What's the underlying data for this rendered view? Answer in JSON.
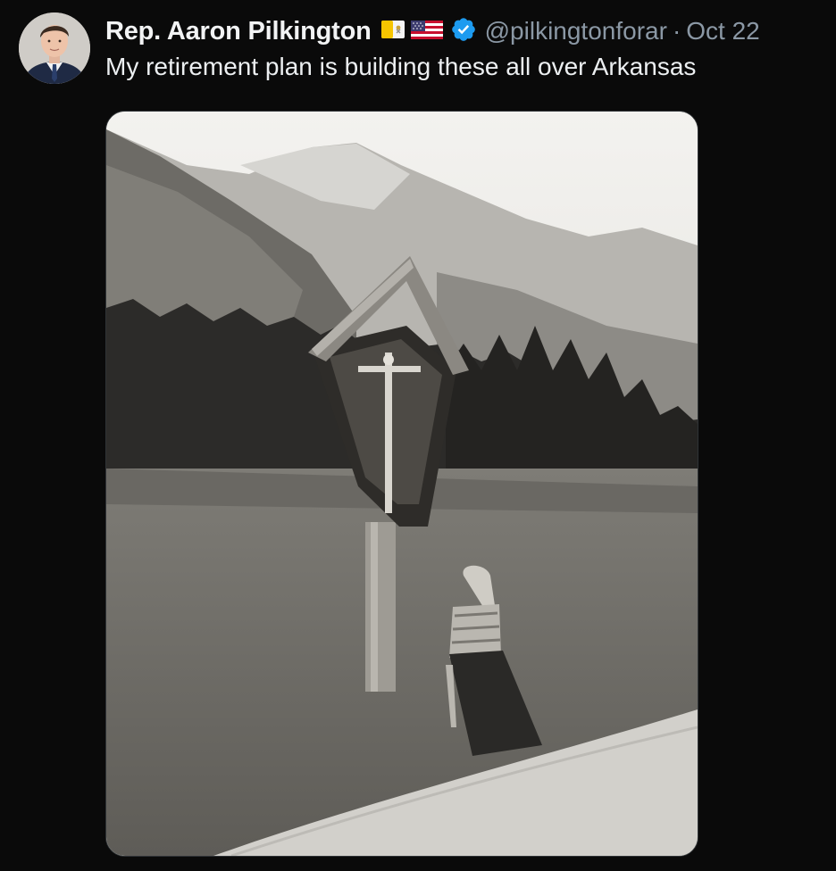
{
  "tweet": {
    "author": {
      "display_name": "Rep. Aaron Pilkington",
      "handle": "@pilkingtonforar",
      "verified": true,
      "flags": [
        "vatican-flag-icon",
        "us-flag-icon"
      ]
    },
    "separator": "·",
    "date": "Oct 22",
    "text": "My retirement plan is building these all over Arkansas",
    "media": {
      "type": "photo",
      "style": "black-and-white"
    }
  },
  "colors": {
    "background": "#0a0a0a",
    "text": "#e7e9ea",
    "secondary_text": "#8b98a5",
    "verified_badge": "#1d9bf0"
  }
}
